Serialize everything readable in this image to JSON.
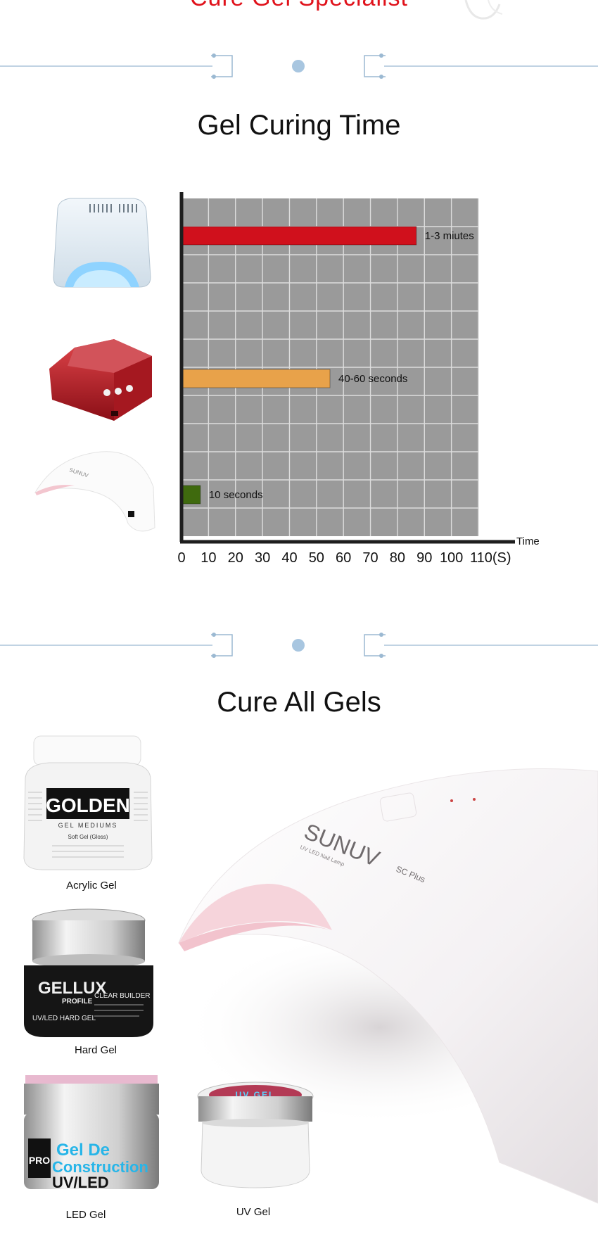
{
  "header": {
    "partial_title": "Cure Gel Specialist"
  },
  "curing_section": {
    "title": "Gel Curing Time"
  },
  "gels_section": {
    "title": "Cure All Gels"
  },
  "chart_data": {
    "type": "bar",
    "orientation": "horizontal",
    "title": "Gel Curing Time",
    "xlabel": "Time",
    "x_unit": "(S)",
    "xlim": [
      0,
      110
    ],
    "x_ticks": [
      "0",
      "10",
      "20",
      "30",
      "40",
      "50",
      "60",
      "70",
      "80",
      "90",
      "100",
      "110(S)"
    ],
    "categories": [
      "UV lamp",
      "CCFL LED lamp",
      "SUNUV LED lamp"
    ],
    "values": [
      87,
      55,
      7
    ],
    "bar_labels": [
      "1-3 miutes",
      "40-60 seconds",
      "10 seconds"
    ],
    "colors": [
      "#d0101c",
      "#e8a24a",
      "#3f6a0e"
    ],
    "plot_background": "#9a9a9a",
    "grid": true
  },
  "products": [
    {
      "label": "Acrylic Gel",
      "brand": "GOLDEN",
      "sub": "GEL MEDIUMS",
      "line": "Soft Gel (Gloss)"
    },
    {
      "label": "Hard Gel",
      "brand": "GELLUX",
      "sub": "PROFILE",
      "line": "CLEAR BUILDER",
      "line2": "UV/LED HARD GEL"
    },
    {
      "label": "LED  Gel",
      "brand": "PRO",
      "sub": "Gel De",
      "line": "Construction",
      "line2": "UV/LED"
    },
    {
      "label": "UV  Gel",
      "brand": "UV GEL"
    }
  ],
  "lamp": {
    "brand": "SUNUV",
    "model": "SC Plus",
    "caption": "UV LED Nail Lamp"
  },
  "colors": {
    "accent_red": "#e0121b",
    "divider": "#9bb9d2"
  }
}
